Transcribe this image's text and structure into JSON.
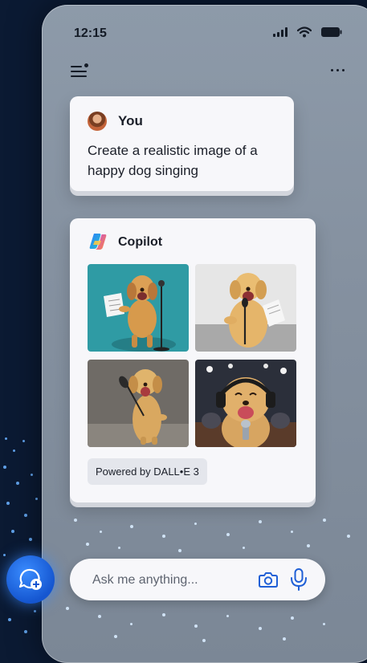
{
  "status_bar": {
    "time": "12:15"
  },
  "chat": {
    "user_message": {
      "sender": "You",
      "text": "Create a realistic image of a happy dog singing"
    },
    "copilot_message": {
      "sender": "Copilot",
      "images": [
        {
          "icon": "dog-singing-image"
        },
        {
          "icon": "dog-singing-image"
        },
        {
          "icon": "dog-singing-image"
        },
        {
          "icon": "dog-singing-image"
        }
      ],
      "powered_by": "Powered by DALL•E 3"
    }
  },
  "composer": {
    "placeholder": "Ask me anything..."
  },
  "colors": {
    "accent": "#1556d0",
    "icon_blue": "#1f5fd6",
    "card": "#f7f7fa"
  }
}
